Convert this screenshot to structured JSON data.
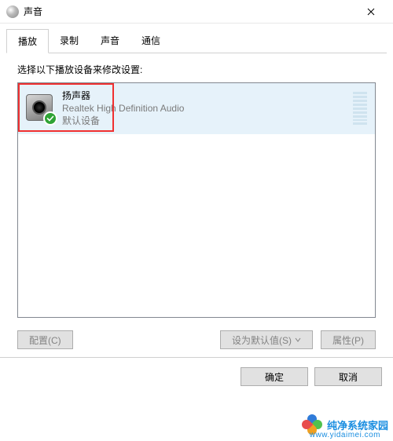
{
  "titlebar": {
    "title": "声音"
  },
  "tabs": [
    {
      "label": "播放",
      "active": true
    },
    {
      "label": "录制",
      "active": false
    },
    {
      "label": "声音",
      "active": false
    },
    {
      "label": "通信",
      "active": false
    }
  ],
  "instruction": "选择以下播放设备来修改设置:",
  "device": {
    "name": "扬声器",
    "description": "Realtek High Definition Audio",
    "status": "默认设备"
  },
  "buttons": {
    "configure": "配置(C)",
    "setDefault": "设为默认值(S)",
    "properties": "属性(P)",
    "ok": "确定",
    "cancel": "取消"
  },
  "watermark": {
    "text": "纯净系统家园",
    "url": "www.yidaimei.com"
  }
}
